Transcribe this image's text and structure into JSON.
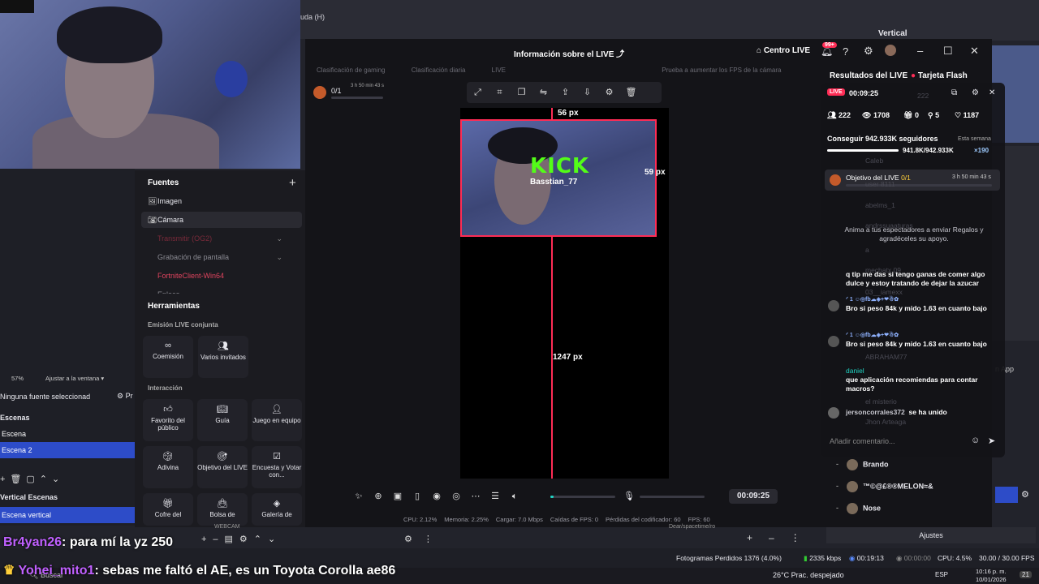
{
  "obs": {
    "menu_item": "uda (H)",
    "right_panel_title": "Vertical",
    "zoom": "57%",
    "fit_mode": "Ajustar a la ventana",
    "no_source": "Ninguna fuente seleccionad",
    "props_label": "Pr",
    "scenes_title": "Escenas",
    "scenes": [
      "Escena",
      "Escena 2"
    ],
    "vertical_scenes_title": "Vertical Escenas",
    "vertical_scenes": [
      "Escena vertical"
    ],
    "right_app_label": "n App",
    "users": [
      "Brando",
      "™©@£®®MELON≈&",
      "Nose"
    ],
    "adjust_button": "Ajustes",
    "left_mini_label": "WEBCAM",
    "right_mini_label": "Dear/spacetime/ro",
    "status": {
      "dropped": "Fotogramas Perdidos 1376 (4.0%)",
      "kbps": "2335 kbps",
      "rec_time": "00:19:13",
      "stream_time": "00:00:00",
      "cpu": "CPU: 4.5%",
      "fps": "30.00 / 30.00 FPS"
    }
  },
  "studio": {
    "title": "Información sobre el LIVE",
    "centro_live": "Centro LIVE",
    "notif_count": "99+",
    "tabs": [
      "Clasificación de gaming",
      "Clasificación diaria",
      "LIVE",
      "Prueba a aumentar los FPS de la cámara"
    ],
    "gift_goal": {
      "count": "0/1",
      "time": "3 h 50 min 43 s",
      "progress": 0
    },
    "sources_title": "Fuentes",
    "sources": [
      {
        "label": "Imagen",
        "icon": "image-icon",
        "state": "normal"
      },
      {
        "label": "Cámara",
        "icon": "camera-icon",
        "state": "selected"
      },
      {
        "label": "Transmitir (OG2)",
        "icon": "none",
        "state": "error"
      },
      {
        "label": "Grabación de pantalla",
        "icon": "none",
        "state": "dim"
      },
      {
        "label": "FortniteClient-Win64",
        "icon": "none",
        "state": "error"
      },
      {
        "label": "Enlace",
        "icon": "none",
        "state": "dim"
      }
    ],
    "tools_title": "Herramientas",
    "co_live_title": "Emisión LIVE conjunta",
    "co_live_tools": [
      "Coemisión",
      "Varios invitados"
    ],
    "interaction_title": "Interacción",
    "interaction_tools": [
      "Favorito del público",
      "Guía",
      "Juego en equipo",
      "Adivina",
      "Objetivo del LIVE",
      "Encuesta y Votar con...",
      "Cofre del",
      "Bolsa de",
      "Galería de"
    ],
    "canvas": {
      "top_measure": "56 px",
      "right_measure": "59 px",
      "height_measure": "1247 px",
      "kick_logo": "KICK",
      "kick_user": "Basstian_77"
    },
    "timer": "00:09:25",
    "volume_level": 0.05,
    "stats": [
      "CPU: 2.12%",
      "Memoria: 2.25%",
      "Cargar: 7.0 Mbps",
      "Caídas de FPS: 0",
      "Pérdidas del codificador: 60",
      "FPS: 60"
    ]
  },
  "results": {
    "title": "Resultados del LIVE",
    "flash_card": "Tarjeta Flash",
    "live_badge": "LIVE",
    "live_time": "00:09:25",
    "ghost_222": "222",
    "viewers": "222",
    "views": "1708",
    "gifts": "0",
    "shares": "5",
    "likes": "1187",
    "follow_goal": "Conseguir 942.933K seguidores",
    "week_label": "Esta semana",
    "follow_progress": "941.8K/942.933K",
    "follow_fraction": 0.999,
    "multiplier": "×190",
    "live_goal": "Objetivo del LIVE",
    "live_goal_count": "0/1",
    "live_goal_time": "3 h 50 min 43 s",
    "gift_hint": "Anima a tus espectadores a enviar Regalos y agradéceles su apoyo.",
    "ghost_names": [
      "Caleb",
      "user 8111",
      "abelms_1",
      "andrssuaaturas",
      "a",
      "mechatx 09",
      "03__iamexx",
      "ABRAHAM77",
      "el misterio",
      "Jhon Arteaga"
    ],
    "messages": [
      {
        "user": "",
        "text": "q tip me das si tengo ganas de comer algo dulce y estoy tratando de dejar la azucar"
      },
      {
        "user": "",
        "badge": "1",
        "text": "Bro si peso 84k y mido 1.63 en cuanto bajo"
      },
      {
        "user": "",
        "badge": "1",
        "text": "Bro si peso 84k y mido 1.63 en cuanto bajo"
      },
      {
        "user": "daniel",
        "text": "que aplicación recomiendas para contar macros?"
      }
    ],
    "joined_user": "jersoncorrales372",
    "joined_text": "se ha unido",
    "comment_placeholder": "Añadir comentario..."
  },
  "overlay_chat": [
    {
      "name": "Br4yan26",
      "text": ": para mí la yz 250"
    },
    {
      "name": "Yohei_mito1",
      "text": ": sebas me faltó el AE, es un Toyota Corolla ae86"
    }
  ],
  "taskbar": {
    "search": "Buscar",
    "weather": "26°C  Prac. despejado",
    "lang": "ESP",
    "time": "10:16 p. m.",
    "date": "10/01/2026",
    "badge": "21"
  },
  "colors": {
    "accent": "#fe2c55",
    "obs_select": "#2d4cc8",
    "kick_green": "#53fc18"
  }
}
